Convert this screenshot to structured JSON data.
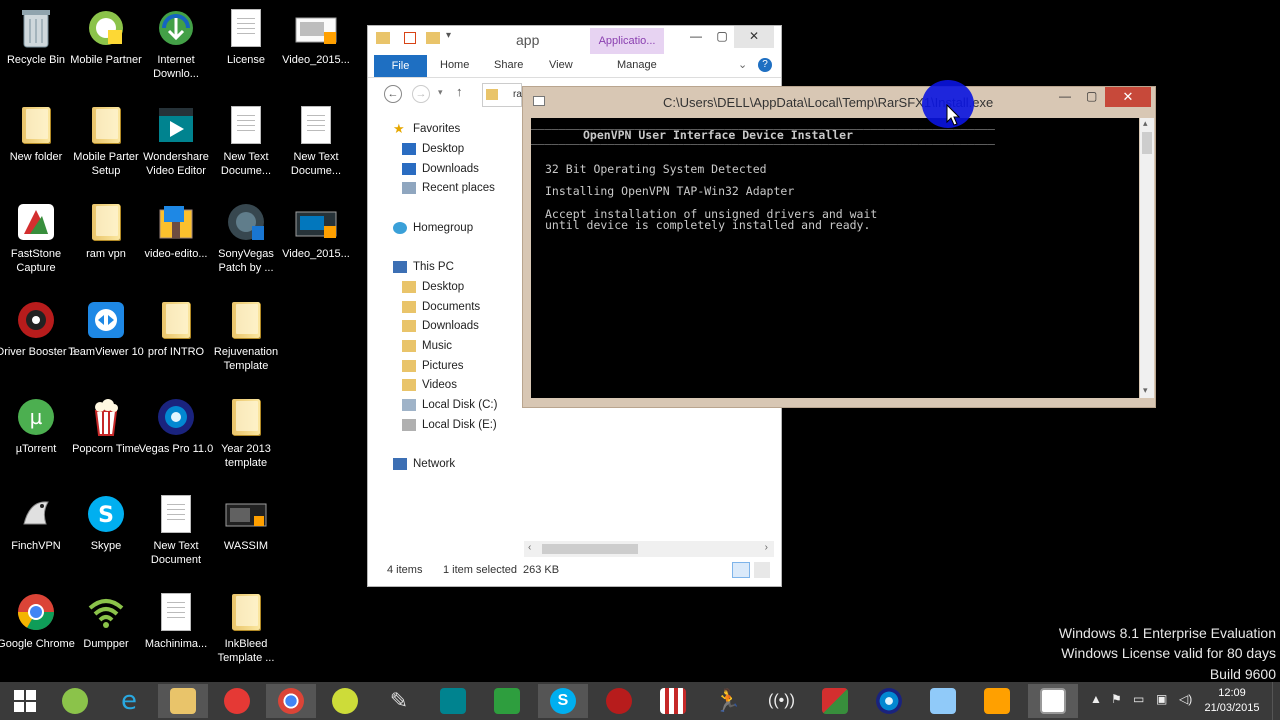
{
  "desktop": {
    "icons": [
      {
        "label": "Recycle Bin"
      },
      {
        "label": "Mobile Partner"
      },
      {
        "label": "Internet Downlo..."
      },
      {
        "label": "License"
      },
      {
        "label": "Video_2015..."
      },
      {
        "label": "New folder"
      },
      {
        "label": "Mobile Parter Setup"
      },
      {
        "label": "Wondershare Video Editor"
      },
      {
        "label": "New Text Docume..."
      },
      {
        "label": "New Text Docume..."
      },
      {
        "label": "FastStone Capture"
      },
      {
        "label": "ram vpn"
      },
      {
        "label": "video-edito..."
      },
      {
        "label": "SonyVegas Patch by ..."
      },
      {
        "label": "Video_2015..."
      },
      {
        "label": "Driver Booster 2"
      },
      {
        "label": "TeamViewer 10"
      },
      {
        "label": "prof INTRO"
      },
      {
        "label": "Rejuvenation Template"
      },
      {
        "label": "µTorrent"
      },
      {
        "label": "Popcorn Time"
      },
      {
        "label": "Vegas Pro 11.0"
      },
      {
        "label": "Year 2013 template"
      },
      {
        "label": "FinchVPN"
      },
      {
        "label": "Skype"
      },
      {
        "label": "New Text Document"
      },
      {
        "label": "WASSIM"
      },
      {
        "label": "Google Chrome"
      },
      {
        "label": "Dumpper"
      },
      {
        "label": "Machinima..."
      },
      {
        "label": "InkBleed Template ..."
      }
    ]
  },
  "explorer": {
    "title": "app",
    "context_tab": "Applicatio...",
    "ribbon": {
      "file": "File",
      "home": "Home",
      "share": "Share",
      "view": "View",
      "manage": "Manage"
    },
    "address_fragment": "ra",
    "nav": {
      "favorites": "Favorites",
      "desktop": "Desktop",
      "downloads": "Downloads",
      "recent": "Recent places",
      "homegroup": "Homegroup",
      "this_pc": "This PC",
      "pc_desktop": "Desktop",
      "documents": "Documents",
      "pc_downloads": "Downloads",
      "music": "Music",
      "pictures": "Pictures",
      "videos": "Videos",
      "local_c": "Local Disk (C:)",
      "local_e": "Local Disk (E:)",
      "network": "Network"
    },
    "status": {
      "items": "4 items",
      "selected": "1 item selected",
      "size": "263 KB"
    }
  },
  "console": {
    "title": "C:\\Users\\DELL\\AppData\\Local\\Temp\\RarSFX1\\Install.exe",
    "separator": "___________________________________________________________________",
    "header": "OpenVPN User Interface Device Installer",
    "line1": "32 Bit Operating System Detected",
    "line2": "Installing OpenVPN TAP-Win32 Adapter",
    "line3": "Accept installation of unsigned drivers and wait",
    "line4": "until device is completely installed and ready."
  },
  "watermark": {
    "line1": "Windows 8.1 Enterprise Evaluation",
    "line2": "Windows License valid for 80 days",
    "line3": "Build 9600"
  },
  "taskbar": {
    "time": "12:09",
    "date": "21/03/2015"
  }
}
